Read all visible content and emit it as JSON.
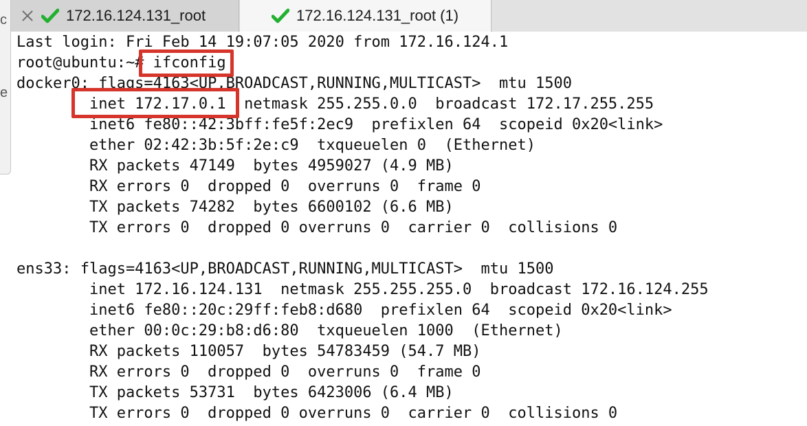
{
  "tabs": [
    {
      "label": "172.16.124.131_root",
      "active": false,
      "status_icon": "checkmark-icon",
      "close_icon": "close-icon"
    },
    {
      "label": "172.16.124.131_root (1)",
      "active": true,
      "status_icon": "checkmark-icon"
    }
  ],
  "colors": {
    "check": "#22b02f",
    "highlight": "#d6352b",
    "text": "#111111"
  },
  "left_window_glyphs": [
    "c",
    "e"
  ],
  "terminal": {
    "lines": [
      "Last login: Fri Feb 14 19:07:05 2020 from 172.16.124.1",
      "root@ubuntu:~# ifconfig",
      "docker0: flags=4163<UP,BROADCAST,RUNNING,MULTICAST>  mtu 1500",
      "        inet 172.17.0.1  netmask 255.255.0.0  broadcast 172.17.255.255",
      "        inet6 fe80::42:3bff:fe5f:2ec9  prefixlen 64  scopeid 0x20<link>",
      "        ether 02:42:3b:5f:2e:c9  txqueuelen 0  (Ethernet)",
      "        RX packets 47149  bytes 4959027 (4.9 MB)",
      "        RX errors 0  dropped 0  overruns 0  frame 0",
      "        TX packets 74282  bytes 6600102 (6.6 MB)",
      "        TX errors 0  dropped 0 overruns 0  carrier 0  collisions 0",
      "",
      "ens33: flags=4163<UP,BROADCAST,RUNNING,MULTICAST>  mtu 1500",
      "        inet 172.16.124.131  netmask 255.255.255.0  broadcast 172.16.124.255",
      "        inet6 fe80::20c:29ff:feb8:d680  prefixlen 64  scopeid 0x20<link>",
      "        ether 00:0c:29:b8:d6:80  txqueuelen 1000  (Ethernet)",
      "        RX packets 110057  bytes 54783459 (54.7 MB)",
      "        RX errors 0  dropped 0  overruns 0  frame 0",
      "        TX packets 53731  bytes 6423006 (6.4 MB)",
      "        TX errors 0  dropped 0 overruns 0  carrier 0  collisions 0"
    ]
  }
}
